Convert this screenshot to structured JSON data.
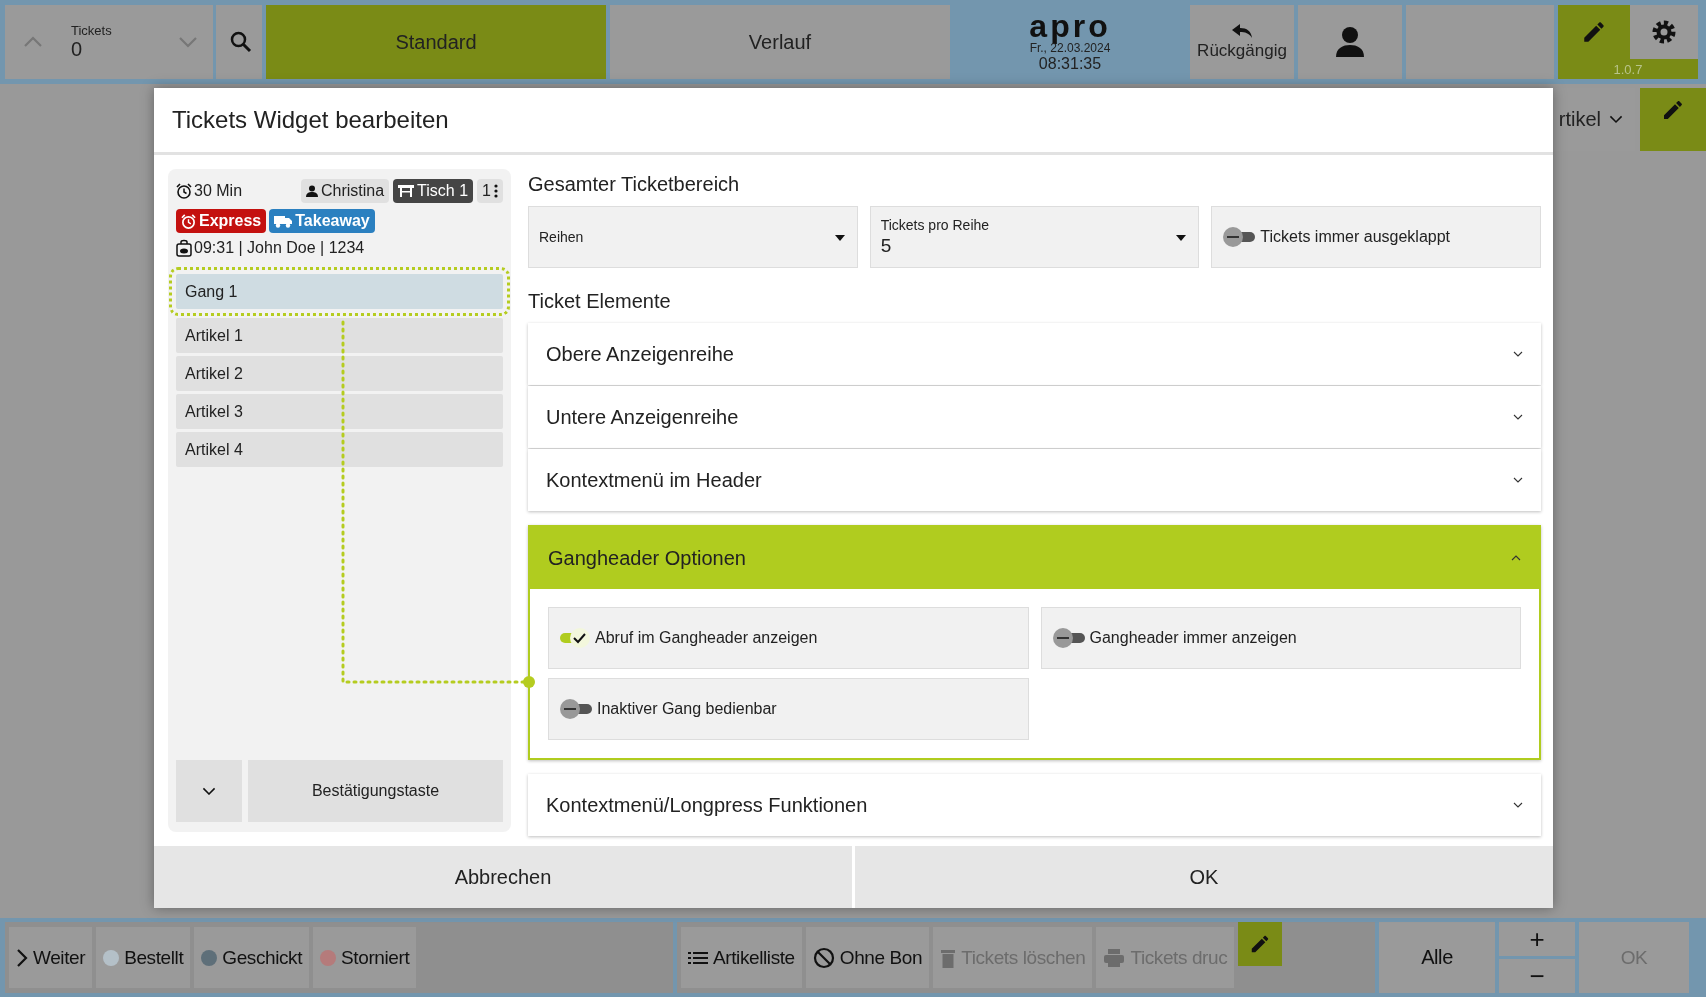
{
  "top_bar": {
    "tickets_label": "Tickets",
    "tickets_count": "0",
    "tabs": [
      {
        "label": "Standard",
        "selected": true
      },
      {
        "label": "Verlauf",
        "selected": false
      }
    ],
    "logo": "apro",
    "date": "Fr., 22.03.2024",
    "time": "08:31:35",
    "undo_label": "Rückgängig",
    "edit_mode": true,
    "version": "1.0.7"
  },
  "side_panel": {
    "dropdown_label": "rtikel",
    "edit_mode": true
  },
  "dialog": {
    "title": "Tickets Widget bearbeiten",
    "preview": {
      "timer": "30 Min",
      "waiter": "Christina",
      "table": "Tisch 1",
      "count": "1",
      "tags": [
        {
          "label": "Express",
          "kind": "express",
          "color": "#c4110f"
        },
        {
          "label": "Takeaway",
          "kind": "takeaway",
          "color": "#2b80c0"
        }
      ],
      "info": "09:31 | John Doe | 1234",
      "rows": [
        {
          "label": "Gang 1",
          "selected": true
        },
        {
          "label": "Artikel 1",
          "selected": false
        },
        {
          "label": "Artikel 2",
          "selected": false
        },
        {
          "label": "Artikel 3",
          "selected": false
        },
        {
          "label": "Artikel 4",
          "selected": false
        }
      ],
      "confirm_label": "Bestätigungstaste"
    },
    "area_title": "Gesamter Ticketbereich",
    "area_fields": [
      {
        "kind": "select",
        "label": "Reihen"
      },
      {
        "kind": "select",
        "label": "Tickets pro Reihe",
        "value": "5"
      },
      {
        "kind": "toggle",
        "label": "Tickets immer ausgeklappt",
        "on": false
      }
    ],
    "elements_title": "Ticket Elemente",
    "sections": [
      {
        "title": "Obere Anzeigenreihe",
        "expanded": false
      },
      {
        "title": "Untere Anzeigenreihe",
        "expanded": false
      },
      {
        "title": "Kontextmenü im Header",
        "expanded": false
      },
      {
        "title": "Gangheader Optionen",
        "expanded": true,
        "options": [
          {
            "label": "Abruf im Gangheader anzeigen",
            "on": true
          },
          {
            "label": "Gangheader immer anzeigen",
            "on": false
          },
          {
            "label": "Inaktiver Gang bedienbar",
            "on": false
          }
        ]
      },
      {
        "title": "Kontextmenü/Longpress Funktionen",
        "expanded": false
      }
    ],
    "buttons": [
      "Abbrechen",
      "OK"
    ]
  },
  "bottom_bar": {
    "next_label": "Weiter",
    "filters": [
      {
        "label": "Bestellt",
        "color": "#b4c0c8"
      },
      {
        "label": "Geschickt",
        "color": "#5e6f79"
      },
      {
        "label": "Storniert",
        "color": "#b57b7b"
      }
    ],
    "actions": [
      {
        "label": "Artikelliste",
        "kind": "list",
        "disabled": false
      },
      {
        "label": "Ohne Bon",
        "kind": "nobon",
        "disabled": false
      },
      {
        "label": "Tickets löschen",
        "kind": "delete",
        "disabled": true
      },
      {
        "label": "Tickets druc",
        "kind": "print",
        "disabled": true
      }
    ],
    "edit_mode": true,
    "all_label": "Alle",
    "plus": "+",
    "minus": "−",
    "ok_label": "OK",
    "ok_disabled": true
  }
}
